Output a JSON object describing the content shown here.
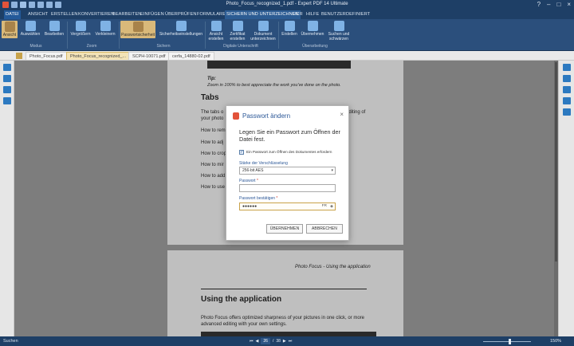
{
  "window": {
    "title": "Photo_Focus_recognized_1.pdf - Expert PDF 14 Ultimate"
  },
  "ribbon_tabs": [
    {
      "label": "DATEI"
    },
    {
      "label": "ANSICHT"
    },
    {
      "label": "ERSTELLEN"
    },
    {
      "label": "KONVERTIEREN"
    },
    {
      "label": "BEARBEITEN"
    },
    {
      "label": "EINFÜGEN"
    },
    {
      "label": "ÜBERPRÜFEN"
    },
    {
      "label": "FORMULARE"
    },
    {
      "label": "SICHERN UND UNTERZEICHNEN"
    },
    {
      "label": "OCR"
    },
    {
      "label": "HILFE"
    },
    {
      "label": "BENUTZERDEFINIERT"
    }
  ],
  "ribbon_buttons": [
    {
      "label": "Ansicht",
      "icon": "hand-icon"
    },
    {
      "label": "Auswählen",
      "icon": "text-select-icon"
    },
    {
      "label": "Bearbeiten",
      "icon": "edit-icon"
    },
    {
      "label": "Vergrößern",
      "icon": "zoom-in-icon"
    },
    {
      "label": "Verkleinern",
      "icon": "zoom-out-icon"
    },
    {
      "label": "Passwortsicherheit",
      "icon": "lock-icon"
    },
    {
      "label": "Sicherheitseinstellungen",
      "icon": "shield-icon"
    },
    {
      "label": "Ansicht erstellen",
      "icon": "signature-view-icon"
    },
    {
      "label": "Zertifikat erstellen",
      "icon": "certificate-icon"
    },
    {
      "label": "Dokument unterzeichnen",
      "icon": "sign-document-icon"
    },
    {
      "label": "Erstellen",
      "icon": "redact-create-icon"
    },
    {
      "label": "Übernehmen",
      "icon": "redact-apply-icon"
    },
    {
      "label": "Suchen und schwärzen",
      "icon": "search-redact-icon"
    }
  ],
  "ribbon_groups": [
    {
      "label": "Modus"
    },
    {
      "label": "Zoom"
    },
    {
      "label": "Sichern"
    },
    {
      "label": "Digitale Unterschrift"
    },
    {
      "label": "Überarbeitung"
    }
  ],
  "doc_tabs": [
    {
      "label": "Photo_Focus.pdf"
    },
    {
      "label": "Photo_Focus_recognized_..."
    },
    {
      "label": "SCPH-10071.pdf"
    },
    {
      "label": "cerfa_14880-02.pdf"
    }
  ],
  "document": {
    "tip_label": "Tip:",
    "tip_text": "Zoom in 100% to best appreciate the work you've done on the photo.",
    "section_title": "Tabs",
    "paragraph_start": "The tabs o",
    "paragraph_start2": "your photo",
    "paragraph_end": "editing of",
    "list_items": [
      "How to rem",
      "How to adj",
      "How to crop",
      "How to mir",
      "How to add",
      "How to use"
    ],
    "running_header": "Photo Focus - Using the application",
    "section2_title": "Using the application",
    "body2_line1": "Photo Focus offers optimized sharpness of your pictures in one click, or more",
    "body2_line2": "advanced editing with your own settings."
  },
  "dialog": {
    "title": "Passwort ändern",
    "close": "×",
    "heading": "Legen Sie ein Passwort zum Öffnen der Datei fest.",
    "checkbox_label": "Ein Passwort zum Öffnen des Dokumentes erfordern",
    "checkbox_checked": true,
    "strength_label": "Stärke der Verschlüsselung",
    "strength_value": "256-bit AES",
    "password_label": "Passwort",
    "password_value": "",
    "confirm_label": "Passwort bestätigen",
    "confirm_value": "●●●●●●",
    "lang": "FR",
    "required_mark": "*",
    "ok_label": "ÜBERNEHMEN",
    "cancel_label": "ABBRECHEN"
  },
  "statusbar": {
    "search": "Suchen",
    "page_current": "26",
    "page_sep": "/",
    "page_total": "38",
    "zoom": "150%"
  }
}
